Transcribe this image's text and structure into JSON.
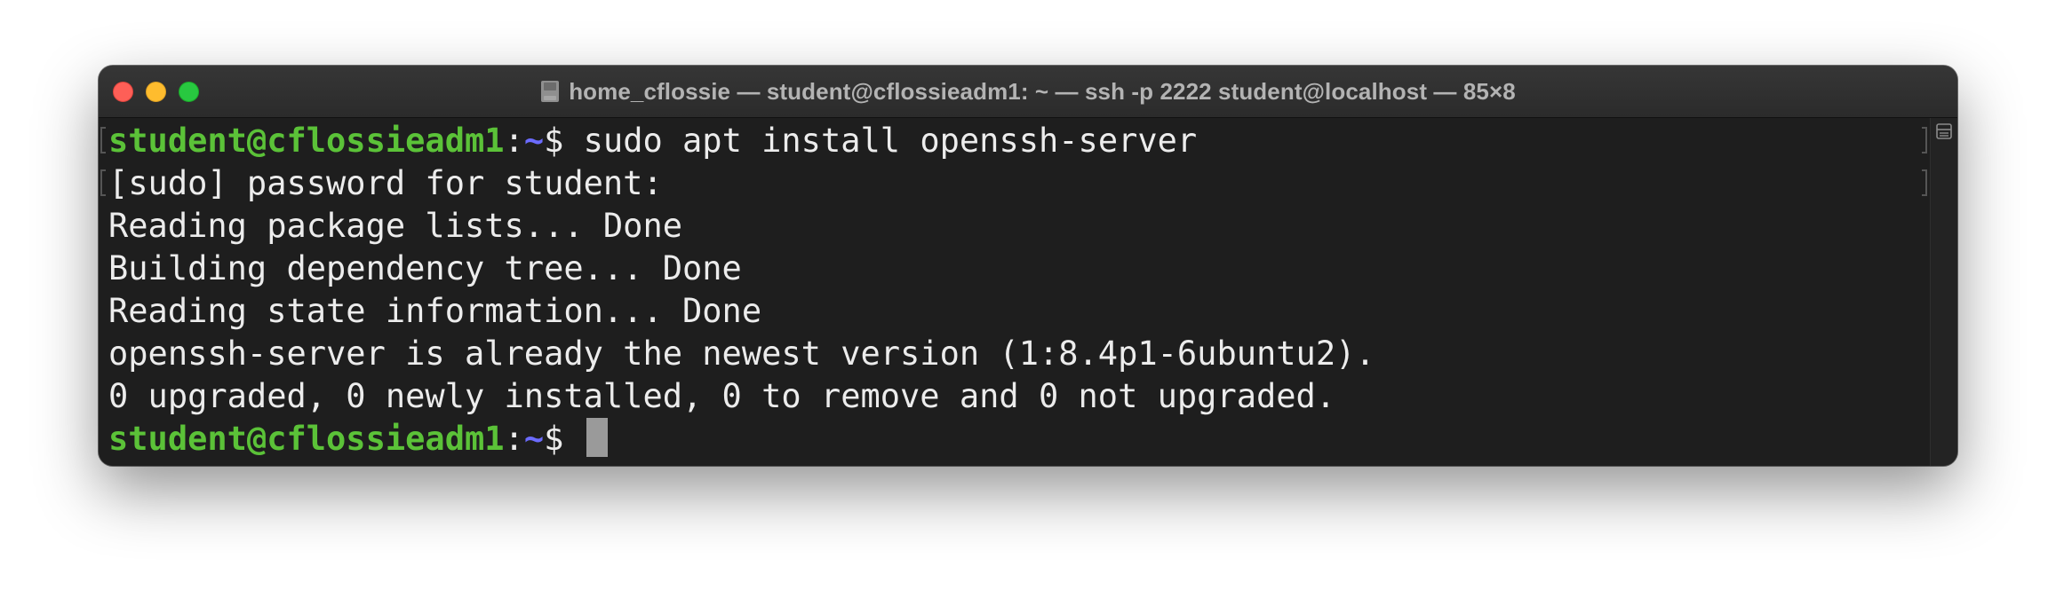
{
  "window": {
    "title": "home_cflossie — student@cflossieadm1: ~ — ssh -p 2222 student@localhost — 85×8",
    "title_icon": "disk-icon"
  },
  "traffic_lights": [
    "close",
    "minimize",
    "zoom"
  ],
  "prompt": {
    "user_host": "student@cflossieadm1",
    "separator": ":",
    "path": "~",
    "symbol": "$"
  },
  "terminal": {
    "command": " sudo apt install openssh-server",
    "lines": [
      "[sudo] password for student:",
      "Reading package lists... Done",
      "Building dependency tree... Done",
      "Reading state information... Done",
      "openssh-server is already the newest version (1:8.4p1-6ubuntu2).",
      "0 upgraded, 0 newly installed, 0 to remove and 0 not upgraded."
    ],
    "cursor_text": " "
  },
  "colors": {
    "prompt_user": "#5bc238",
    "prompt_path": "#6b6bff",
    "background": "#1e1e1e",
    "text": "#ececec",
    "close": "#fe5f57",
    "minimize": "#febc2e",
    "zoom": "#28c840"
  }
}
